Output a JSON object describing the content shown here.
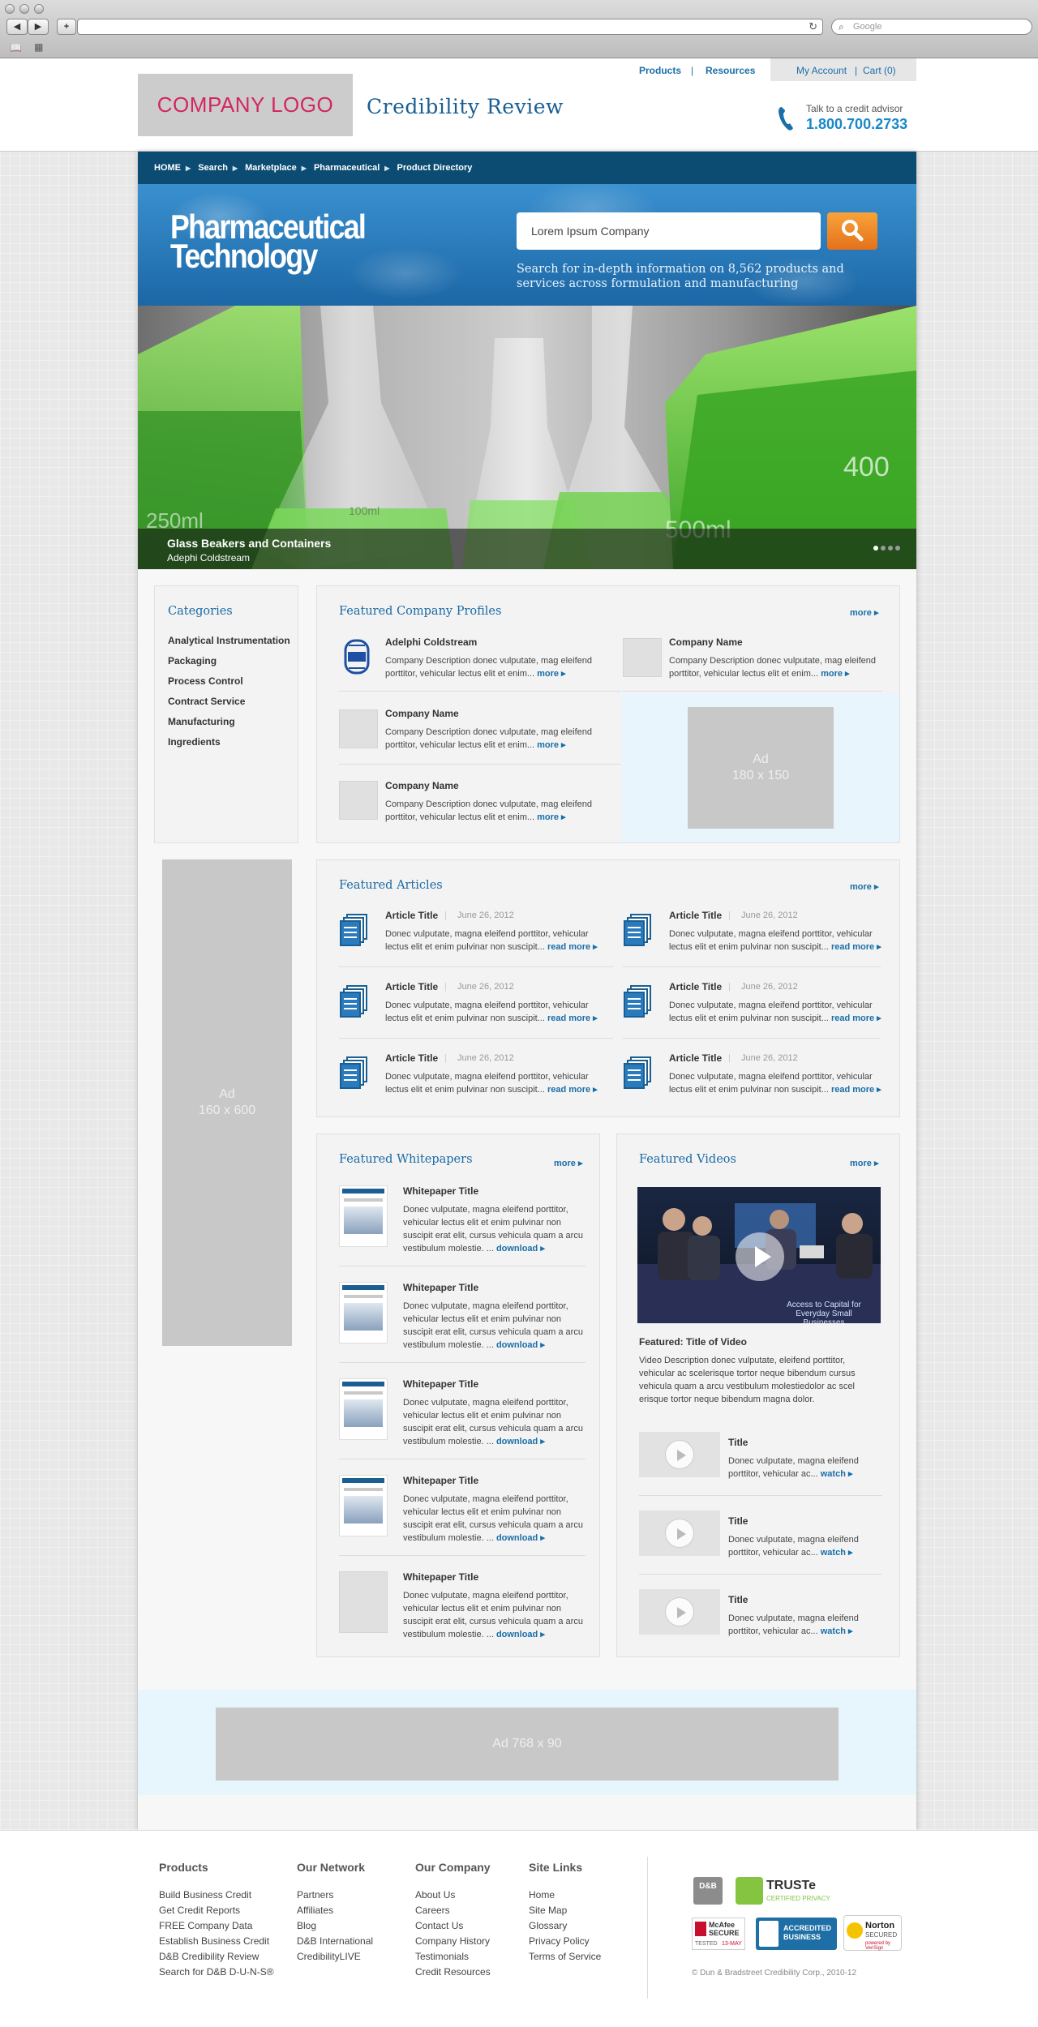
{
  "browser": {
    "search_placeholder": "Google"
  },
  "header": {
    "nav_products": "Products",
    "nav_resources": "Resources",
    "nav_account": "My Account",
    "nav_cart": "Cart (0)",
    "logo_text": "COMPANY LOGO",
    "site_title": "Credibility Review",
    "advisor_label": "Talk to a credit advisor",
    "advisor_phone": "1.800.700.2733"
  },
  "breadcrumb": [
    "HOME",
    "Search",
    "Marketplace",
    "Pharmaceutical",
    "Product Directory"
  ],
  "search": {
    "brand_line1": "Pharmaceutical",
    "brand_line2": "Technology",
    "input_value": "Lorem Ipsum Company",
    "note": "Search for in-depth information on 8,562 products and services across formulation and manufacturing"
  },
  "hero": {
    "title": "Glass Beakers and Containers",
    "subtitle": "Adephi Coldstream",
    "volume_label_1": "400",
    "volume_label_2": "500ml",
    "volume_label_3": "100ml",
    "volume_label_4": "250ml"
  },
  "categories": {
    "title": "Categories",
    "items": [
      "Analytical Instrumentation",
      "Packaging",
      "Process Control",
      "Contract Service",
      "Manufacturing",
      "Ingredients"
    ]
  },
  "profiles": {
    "title": "Featured Company Profiles",
    "more": "more ▸",
    "items": [
      {
        "name": "Adelphi Coldstream",
        "desc": "Company Description donec vulputate, mag eleifend porttitor, vehicular lectus elit et enim...",
        "more": "more ▸"
      },
      {
        "name": "Company Name",
        "desc": "Company Description donec vulputate, mag eleifend porttitor, vehicular lectus elit et enim...",
        "more": "more ▸"
      },
      {
        "name": "Company Name",
        "desc": "Company Description donec vulputate, mag eleifend porttitor, vehicular lectus elit et enim...",
        "more": "more ▸"
      },
      {
        "name": "Company Name",
        "desc": "Company Description donec vulputate, mag eleifend porttitor, vehicular lectus elit et enim...",
        "more": "more ▸"
      }
    ],
    "ad_label": "Ad",
    "ad_size": "180 x 150"
  },
  "side_ad": {
    "label": "Ad",
    "size": "160 x 600"
  },
  "articles": {
    "title": "Featured Articles",
    "more": "more ▸",
    "items": [
      {
        "title": "Article Title",
        "date": "June 26, 2012",
        "desc": "Donec vulputate, magna eleifend porttitor, vehicular lectus elit et enim pulvinar non suscipit...",
        "link": "read more ▸"
      },
      {
        "title": "Article Title",
        "date": "June 26, 2012",
        "desc": "Donec vulputate, magna eleifend porttitor, vehicular lectus elit et enim pulvinar non suscipit...",
        "link": "read more ▸"
      },
      {
        "title": "Article Title",
        "date": "June 26, 2012",
        "desc": "Donec vulputate, magna eleifend porttitor, vehicular lectus elit et enim pulvinar non suscipit...",
        "link": "read more ▸"
      },
      {
        "title": "Article Title",
        "date": "June 26, 2012",
        "desc": "Donec vulputate, magna eleifend porttitor, vehicular lectus elit et enim pulvinar non suscipit...",
        "link": "read more ▸"
      },
      {
        "title": "Article Title",
        "date": "June 26, 2012",
        "desc": "Donec vulputate, magna eleifend porttitor, vehicular lectus elit et enim pulvinar non suscipit...",
        "link": "read more ▸"
      },
      {
        "title": "Article Title",
        "date": "June 26, 2012",
        "desc": "Donec vulputate, magna eleifend porttitor, vehicular lectus elit et enim pulvinar non suscipit...",
        "link": "read more ▸"
      }
    ]
  },
  "whitepapers": {
    "title": "Featured Whitepapers",
    "more": "more ▸",
    "items": [
      {
        "title": "Whitepaper Title",
        "desc": "Donec vulputate, magna eleifend porttitor, vehicular lectus elit et enim pulvinar non suscipit erat elit, cursus vehicula quam a arcu vestibulum molestie. ...",
        "link": "download ▸"
      },
      {
        "title": "Whitepaper Title",
        "desc": "Donec vulputate, magna eleifend porttitor, vehicular lectus elit et enim pulvinar non suscipit erat elit, cursus vehicula quam a arcu vestibulum molestie. ...",
        "link": "download ▸"
      },
      {
        "title": "Whitepaper Title",
        "desc": "Donec vulputate, magna eleifend porttitor, vehicular lectus elit et enim pulvinar non suscipit erat elit, cursus vehicula quam a arcu vestibulum molestie. ...",
        "link": "download ▸"
      },
      {
        "title": "Whitepaper Title",
        "desc": "Donec vulputate, magna eleifend porttitor, vehicular lectus elit et enim pulvinar non suscipit erat elit, cursus vehicula quam a arcu vestibulum molestie. ...",
        "link": "download ▸"
      },
      {
        "title": "Whitepaper Title",
        "desc": "Donec vulputate, magna eleifend porttitor, vehicular lectus elit et enim pulvinar non suscipit erat elit, cursus vehicula quam a arcu vestibulum molestie. ...",
        "link": "download ▸"
      }
    ]
  },
  "videos": {
    "title": "Featured Videos",
    "more": "more ▸",
    "featured_caption": "Access to Capital for Everyday Small Businesses",
    "featured_title": "Featured: Title of Video",
    "featured_desc": "Video Description donec vulputate, eleifend porttitor, vehicular ac scelerisque tortor neque bibendum cursus vehicula quam a arcu vestibulum molestiedolor ac scel erisque tortor neque bibendum magna dolor.",
    "items": [
      {
        "title": "Title",
        "desc": "Donec vulputate, magna eleifend porttitor, vehicular ac...",
        "link": "watch ▸"
      },
      {
        "title": "Title",
        "desc": "Donec vulputate, magna eleifend porttitor, vehicular ac...",
        "link": "watch ▸"
      },
      {
        "title": "Title",
        "desc": "Donec vulputate, magna eleifend porttitor, vehicular ac...",
        "link": "watch ▸"
      }
    ]
  },
  "bottom_ad": "Ad 768 x 90",
  "footer": {
    "columns": [
      {
        "heading": "Products",
        "links": [
          "Build Business Credit",
          "Get Credit Reports",
          "FREE Company Data",
          "Establish Business Credit",
          "D&B Credibility Review",
          "Search for D&B D-U-N-S®"
        ]
      },
      {
        "heading": "Our Network",
        "links": [
          "Partners",
          "Affiliates",
          "Blog",
          "D&B International",
          "CredibilityLIVE"
        ]
      },
      {
        "heading": "Our Company",
        "links": [
          "About Us",
          "Careers",
          "Contact Us",
          "Company History",
          "Testimonials",
          "Credit Resources"
        ]
      },
      {
        "heading": "Site Links",
        "links": [
          "Home",
          "Site Map",
          "Glossary",
          "Privacy Policy",
          "Terms of Service"
        ]
      }
    ],
    "badges": {
      "dnb": "D&B",
      "truste": "TRUSTe",
      "truste_sub": "CERTIFIED PRIVACY",
      "mcafee": "McAfee SECURE",
      "mcafee_tested": "TESTED",
      "mcafee_date": "13-MAY",
      "bbb": "ACCREDITED BUSINESS",
      "norton": "Norton",
      "norton_sub": "SECURED",
      "norton_by": "powered by VeriSign"
    },
    "copyright": "© Dun & Bradstreet Credibility Corp., 2010-12"
  }
}
